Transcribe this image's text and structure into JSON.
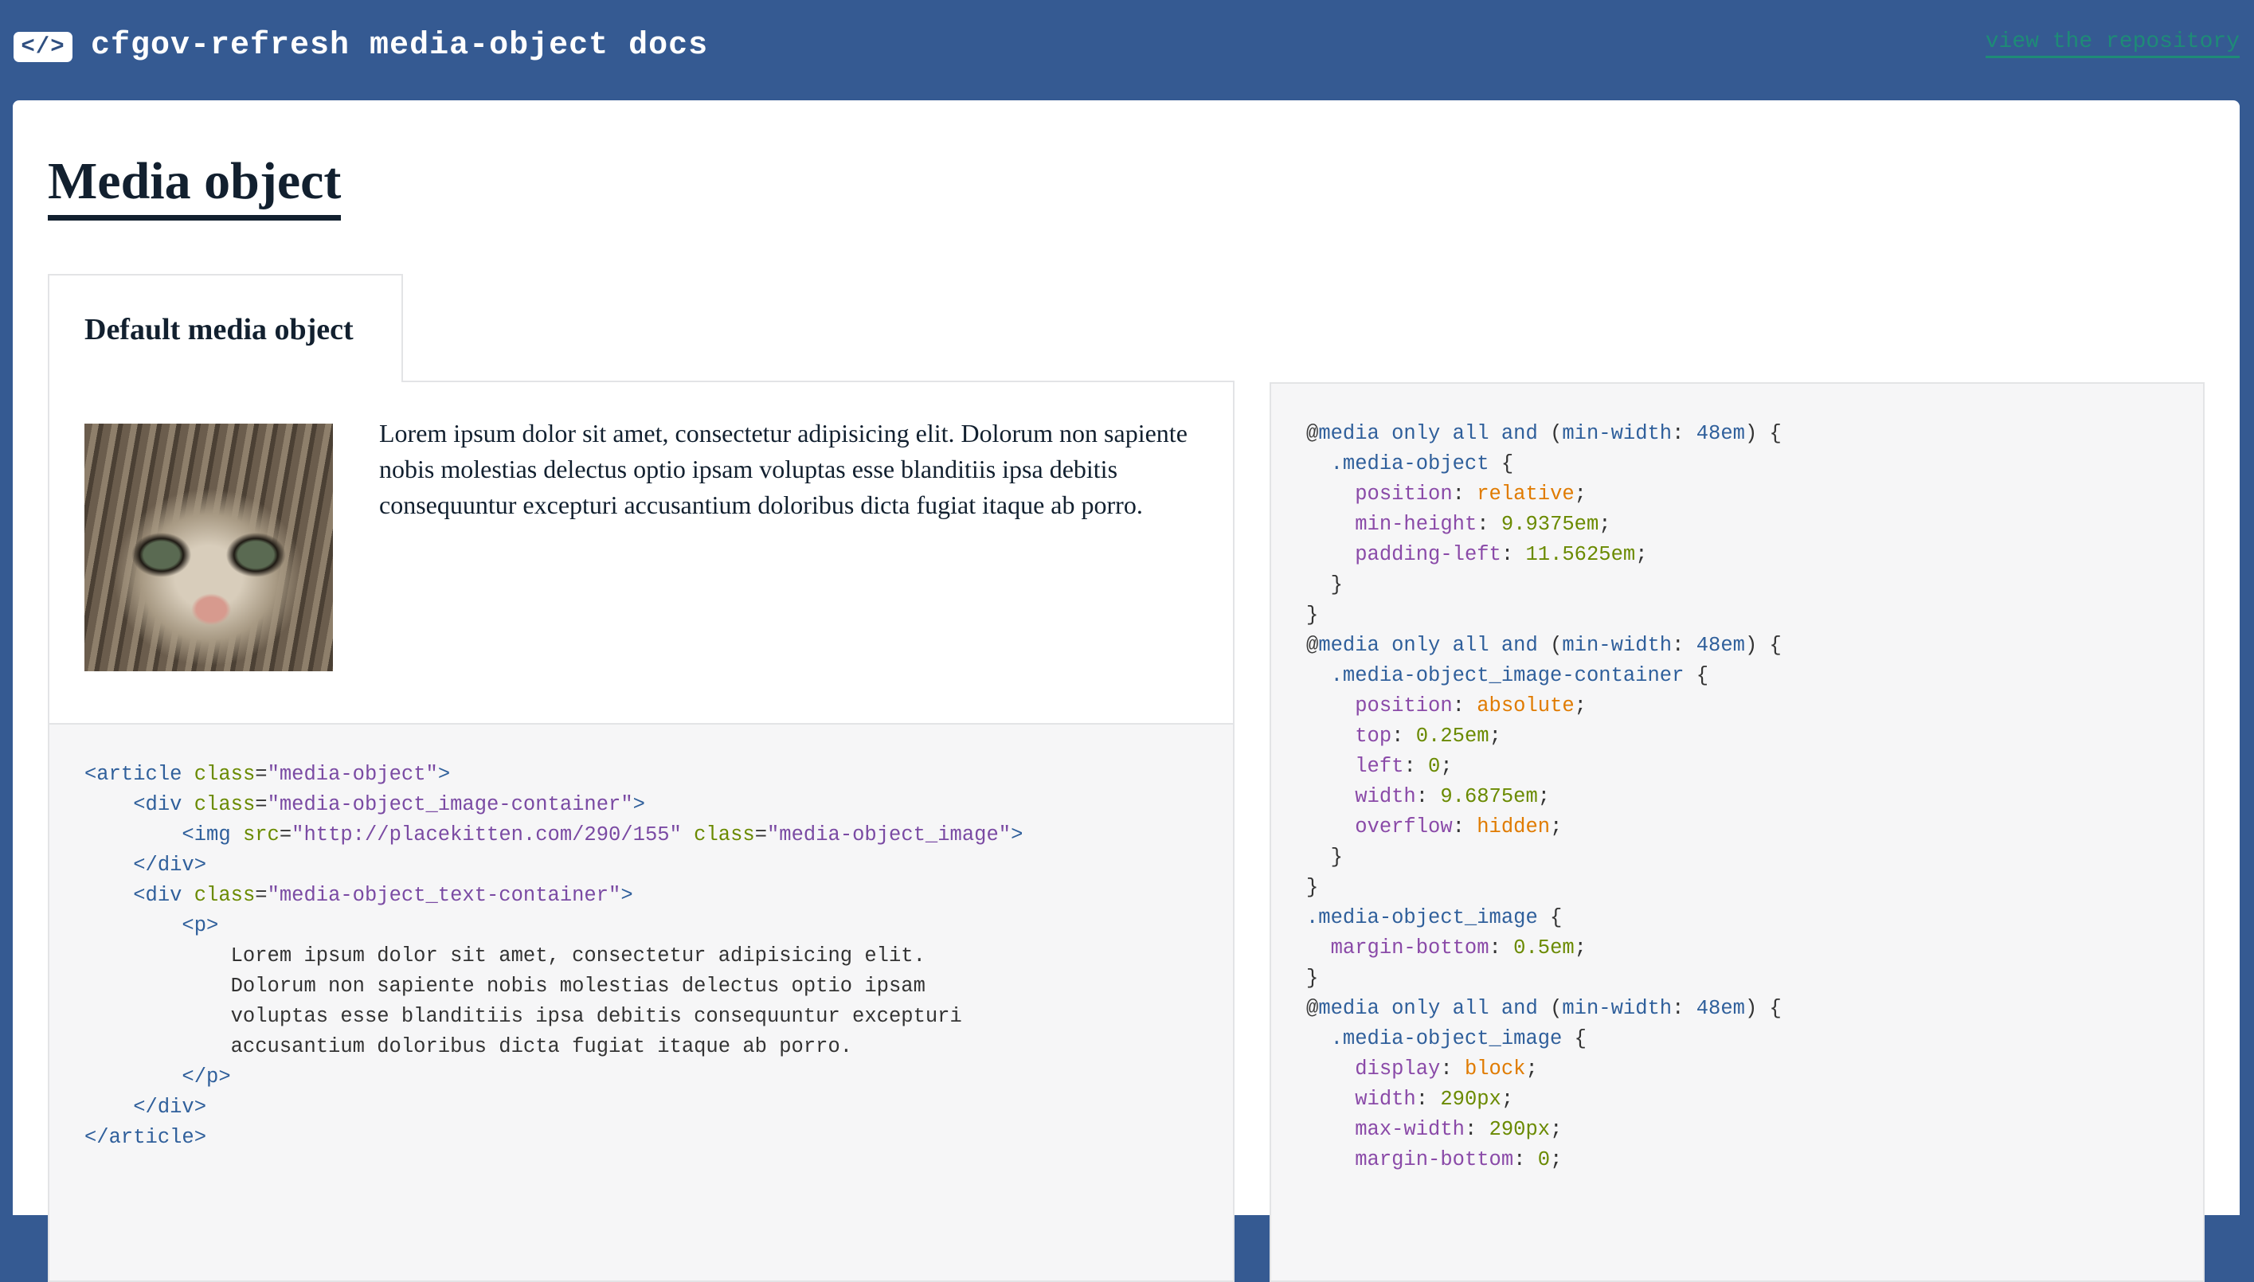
{
  "header": {
    "badge": "</>",
    "title": "cfgov-refresh media-object docs",
    "repo_link": "view the repository"
  },
  "page": {
    "title": "Media object",
    "tab_label": "Default media object",
    "demo_text": "Lorem ipsum dolor sit amet, consectetur adipisicing elit. Dolorum non sapiente nobis molestias delectus optio ipsam voluptas esse blanditiis ipsa debitis consequuntur excepturi accusantium doloribus dicta fugiat itaque ab porro.",
    "image_alt": "kitten photo"
  },
  "html_code": [
    [
      {
        "c": "tag",
        "t": "<article "
      },
      {
        "c": "attr",
        "t": "class"
      },
      {
        "c": "pun",
        "t": "="
      },
      {
        "c": "val",
        "t": "\"media-object\""
      },
      {
        "c": "tag",
        "t": ">"
      }
    ],
    [
      {
        "c": "pun",
        "t": "    "
      },
      {
        "c": "tag",
        "t": "<div "
      },
      {
        "c": "attr",
        "t": "class"
      },
      {
        "c": "pun",
        "t": "="
      },
      {
        "c": "val",
        "t": "\"media-object_image-container\""
      },
      {
        "c": "tag",
        "t": ">"
      }
    ],
    [
      {
        "c": "pun",
        "t": "        "
      },
      {
        "c": "tag",
        "t": "<img "
      },
      {
        "c": "attr",
        "t": "src"
      },
      {
        "c": "pun",
        "t": "="
      },
      {
        "c": "val",
        "t": "\"http://placekitten.com/290/155\""
      },
      {
        "c": "pun",
        "t": " "
      },
      {
        "c": "attr",
        "t": "class"
      },
      {
        "c": "pun",
        "t": "="
      },
      {
        "c": "val",
        "t": "\"media-object_image\""
      },
      {
        "c": "tag",
        "t": ">"
      }
    ],
    [
      {
        "c": "pun",
        "t": "    "
      },
      {
        "c": "tag",
        "t": "</div>"
      }
    ],
    [
      {
        "c": "pun",
        "t": "    "
      },
      {
        "c": "tag",
        "t": "<div "
      },
      {
        "c": "attr",
        "t": "class"
      },
      {
        "c": "pun",
        "t": "="
      },
      {
        "c": "val",
        "t": "\"media-object_text-container\""
      },
      {
        "c": "tag",
        "t": ">"
      }
    ],
    [
      {
        "c": "pun",
        "t": "        "
      },
      {
        "c": "tag",
        "t": "<p>"
      }
    ],
    [
      {
        "c": "pun",
        "t": "            Lorem ipsum dolor sit amet, consectetur adipisicing elit."
      }
    ],
    [
      {
        "c": "pun",
        "t": "            Dolorum non sapiente nobis molestias delectus optio ipsam"
      }
    ],
    [
      {
        "c": "pun",
        "t": "            voluptas esse blanditiis ipsa debitis consequuntur excepturi"
      }
    ],
    [
      {
        "c": "pun",
        "t": "            accusantium doloribus dicta fugiat itaque ab porro."
      }
    ],
    [
      {
        "c": "pun",
        "t": "        "
      },
      {
        "c": "tag",
        "t": "</p>"
      }
    ],
    [
      {
        "c": "pun",
        "t": "    "
      },
      {
        "c": "tag",
        "t": "</div>"
      }
    ],
    [
      {
        "c": "tag",
        "t": "</article>"
      }
    ]
  ],
  "css_code": [
    [
      {
        "c": "at",
        "t": "@"
      },
      {
        "c": "kw",
        "t": "media only all and "
      },
      {
        "c": "pun",
        "t": "("
      },
      {
        "c": "kw",
        "t": "min-width"
      },
      {
        "c": "pun",
        "t": ": "
      },
      {
        "c": "kw",
        "t": "48em"
      },
      {
        "c": "pun",
        "t": ") {"
      }
    ],
    [
      {
        "c": "pun",
        "t": "  "
      },
      {
        "c": "sel",
        "t": ".media-object"
      },
      {
        "c": "pun",
        "t": " {"
      }
    ],
    [
      {
        "c": "pun",
        "t": "    "
      },
      {
        "c": "prop",
        "t": "position"
      },
      {
        "c": "pun",
        "t": ": "
      },
      {
        "c": "str",
        "t": "relative"
      },
      {
        "c": "pun",
        "t": ";"
      }
    ],
    [
      {
        "c": "pun",
        "t": "    "
      },
      {
        "c": "prop",
        "t": "min-height"
      },
      {
        "c": "pun",
        "t": ": "
      },
      {
        "c": "num",
        "t": "9.9375em"
      },
      {
        "c": "pun",
        "t": ";"
      }
    ],
    [
      {
        "c": "pun",
        "t": "    "
      },
      {
        "c": "prop",
        "t": "padding-left"
      },
      {
        "c": "pun",
        "t": ": "
      },
      {
        "c": "num",
        "t": "11.5625em"
      },
      {
        "c": "pun",
        "t": ";"
      }
    ],
    [
      {
        "c": "pun",
        "t": "  }"
      }
    ],
    [
      {
        "c": "pun",
        "t": "}"
      }
    ],
    [
      {
        "c": "at",
        "t": "@"
      },
      {
        "c": "kw",
        "t": "media only all and "
      },
      {
        "c": "pun",
        "t": "("
      },
      {
        "c": "kw",
        "t": "min-width"
      },
      {
        "c": "pun",
        "t": ": "
      },
      {
        "c": "kw",
        "t": "48em"
      },
      {
        "c": "pun",
        "t": ") {"
      }
    ],
    [
      {
        "c": "pun",
        "t": "  "
      },
      {
        "c": "sel",
        "t": ".media-object_image-container"
      },
      {
        "c": "pun",
        "t": " {"
      }
    ],
    [
      {
        "c": "pun",
        "t": "    "
      },
      {
        "c": "prop",
        "t": "position"
      },
      {
        "c": "pun",
        "t": ": "
      },
      {
        "c": "str",
        "t": "absolute"
      },
      {
        "c": "pun",
        "t": ";"
      }
    ],
    [
      {
        "c": "pun",
        "t": "    "
      },
      {
        "c": "prop",
        "t": "top"
      },
      {
        "c": "pun",
        "t": ": "
      },
      {
        "c": "num",
        "t": "0.25em"
      },
      {
        "c": "pun",
        "t": ";"
      }
    ],
    [
      {
        "c": "pun",
        "t": "    "
      },
      {
        "c": "prop",
        "t": "left"
      },
      {
        "c": "pun",
        "t": ": "
      },
      {
        "c": "num",
        "t": "0"
      },
      {
        "c": "pun",
        "t": ";"
      }
    ],
    [
      {
        "c": "pun",
        "t": "    "
      },
      {
        "c": "prop",
        "t": "width"
      },
      {
        "c": "pun",
        "t": ": "
      },
      {
        "c": "num",
        "t": "9.6875em"
      },
      {
        "c": "pun",
        "t": ";"
      }
    ],
    [
      {
        "c": "pun",
        "t": "    "
      },
      {
        "c": "prop",
        "t": "overflow"
      },
      {
        "c": "pun",
        "t": ": "
      },
      {
        "c": "str",
        "t": "hidden"
      },
      {
        "c": "pun",
        "t": ";"
      }
    ],
    [
      {
        "c": "pun",
        "t": "  }"
      }
    ],
    [
      {
        "c": "pun",
        "t": "}"
      }
    ],
    [
      {
        "c": "sel",
        "t": ".media-object_image"
      },
      {
        "c": "pun",
        "t": " {"
      }
    ],
    [
      {
        "c": "pun",
        "t": "  "
      },
      {
        "c": "prop",
        "t": "margin-bottom"
      },
      {
        "c": "pun",
        "t": ": "
      },
      {
        "c": "num",
        "t": "0.5em"
      },
      {
        "c": "pun",
        "t": ";"
      }
    ],
    [
      {
        "c": "pun",
        "t": "}"
      }
    ],
    [
      {
        "c": "at",
        "t": "@"
      },
      {
        "c": "kw",
        "t": "media only all and "
      },
      {
        "c": "pun",
        "t": "("
      },
      {
        "c": "kw",
        "t": "min-width"
      },
      {
        "c": "pun",
        "t": ": "
      },
      {
        "c": "kw",
        "t": "48em"
      },
      {
        "c": "pun",
        "t": ") {"
      }
    ],
    [
      {
        "c": "pun",
        "t": "  "
      },
      {
        "c": "sel",
        "t": ".media-object_image"
      },
      {
        "c": "pun",
        "t": " {"
      }
    ],
    [
      {
        "c": "pun",
        "t": "    "
      },
      {
        "c": "prop",
        "t": "display"
      },
      {
        "c": "pun",
        "t": ": "
      },
      {
        "c": "str",
        "t": "block"
      },
      {
        "c": "pun",
        "t": ";"
      }
    ],
    [
      {
        "c": "pun",
        "t": "    "
      },
      {
        "c": "prop",
        "t": "width"
      },
      {
        "c": "pun",
        "t": ": "
      },
      {
        "c": "num",
        "t": "290px"
      },
      {
        "c": "pun",
        "t": ";"
      }
    ],
    [
      {
        "c": "pun",
        "t": "    "
      },
      {
        "c": "prop",
        "t": "max-width"
      },
      {
        "c": "pun",
        "t": ": "
      },
      {
        "c": "num",
        "t": "290px"
      },
      {
        "c": "pun",
        "t": ";"
      }
    ],
    [
      {
        "c": "pun",
        "t": "    "
      },
      {
        "c": "prop",
        "t": "margin-bottom"
      },
      {
        "c": "pun",
        "t": ": "
      },
      {
        "c": "num",
        "t": "0"
      },
      {
        "c": "pun",
        "t": ";"
      }
    ]
  ]
}
